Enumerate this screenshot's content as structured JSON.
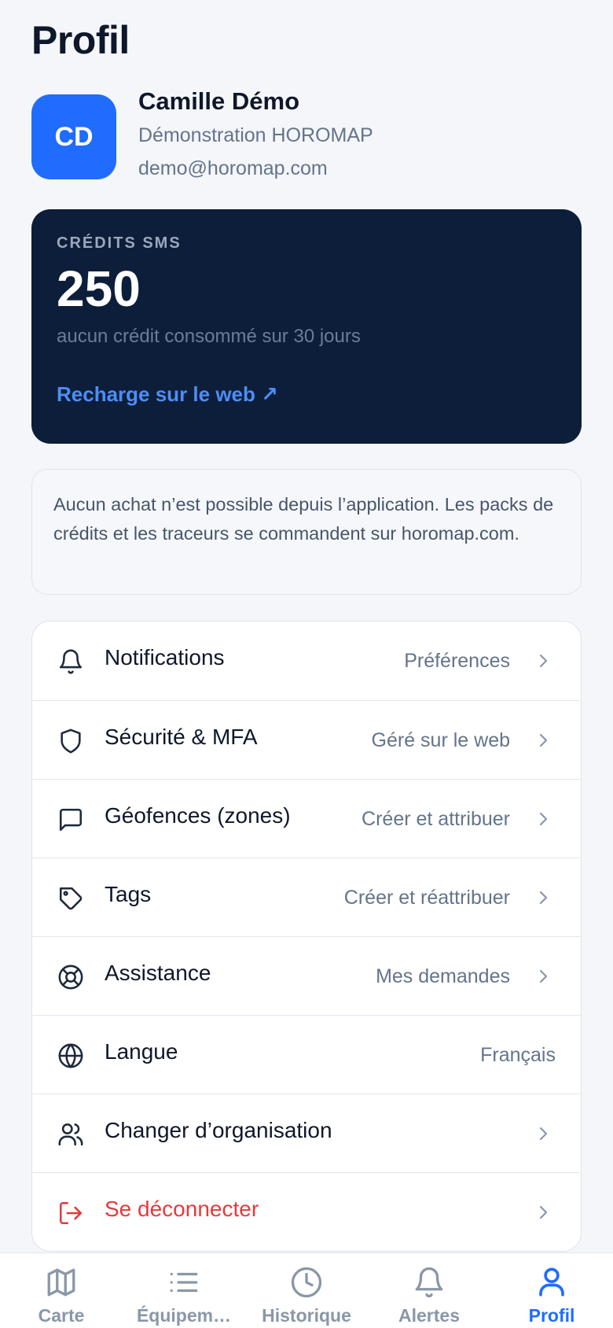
{
  "header": {
    "title": "Profil"
  },
  "user": {
    "initials": "CD",
    "name": "Camille Démo",
    "organization": "Démonstration HOROMAP",
    "email": "demo@horomap.com"
  },
  "credits": {
    "label": "CRÉDITS SMS",
    "value": "250",
    "subtitle": "aucun crédit consommé sur 30 jours",
    "link": "Recharge sur le web ↗"
  },
  "info": {
    "text": "Aucun achat n’est possible depuis l’application. Les packs de crédits et les traceurs se commandent sur horomap.com."
  },
  "menu": {
    "items": [
      {
        "icon": "bell-icon",
        "label": "Notifications",
        "value": "Préférences"
      },
      {
        "icon": "shield-icon",
        "label": "Sécurité & MFA",
        "value": "Géré sur le web"
      },
      {
        "icon": "message-square-icon",
        "label": "Géofences (zones)",
        "value": "Créer et attribuer"
      },
      {
        "icon": "tag-icon",
        "label": "Tags",
        "value": "Créer et réattribuer"
      },
      {
        "icon": "lifebuoy-icon",
        "label": "Assistance",
        "value": "Mes demandes"
      },
      {
        "icon": "globe-icon",
        "label": "Langue",
        "value": "Français"
      },
      {
        "icon": "users-icon",
        "label": "Changer d’organisation",
        "value": ""
      },
      {
        "icon": "logout-icon",
        "label": "Se déconnecter",
        "value": ""
      }
    ]
  },
  "tabbar": {
    "tabs": [
      {
        "icon": "map-icon",
        "label": "Carte"
      },
      {
        "icon": "list-icon",
        "label": "Équipem…"
      },
      {
        "icon": "clock-icon",
        "label": "Historique"
      },
      {
        "icon": "bell-icon",
        "label": "Alertes"
      },
      {
        "icon": "user-icon",
        "label": "Profil"
      }
    ],
    "active": "Profil"
  },
  "colors": {
    "accent": "#1f6cff",
    "card_dark": "#0c1e3a",
    "link": "#4e8df6",
    "danger": "#e23b3b",
    "muted": "#64748b",
    "tab_inactive": "#8a97a8"
  }
}
